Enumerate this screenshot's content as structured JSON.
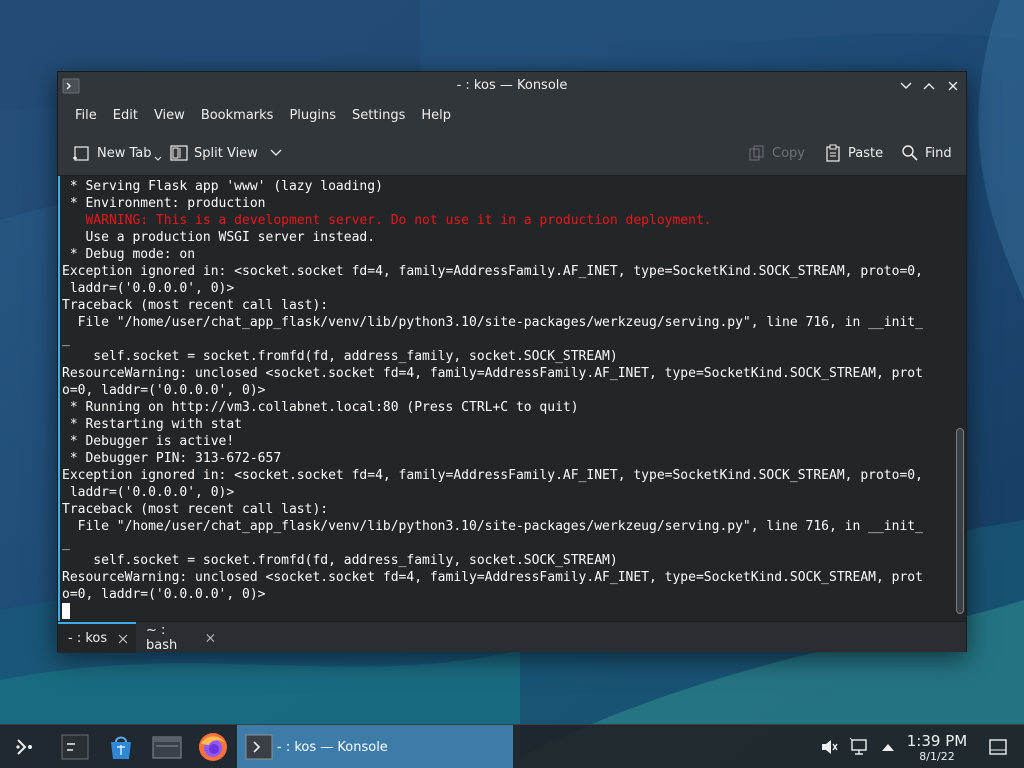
{
  "window": {
    "title": "- : kos — Konsole"
  },
  "menu": [
    "File",
    "Edit",
    "View",
    "Bookmarks",
    "Plugins",
    "Settings",
    "Help"
  ],
  "toolbar": {
    "new_tab": "New Tab",
    "split_view": "Split View",
    "copy": "Copy",
    "paste": "Paste",
    "find": "Find"
  },
  "terminal": {
    "lines": [
      {
        "text": " * Serving Flask app 'www' (lazy loading)",
        "warn": false
      },
      {
        "text": " * Environment: production",
        "warn": false
      },
      {
        "text": "   WARNING: This is a development server. Do not use it in a production deployment.",
        "warn": true
      },
      {
        "text": "   Use a production WSGI server instead.",
        "warn": false
      },
      {
        "text": " * Debug mode: on",
        "warn": false
      },
      {
        "text": "Exception ignored in: <socket.socket fd=4, family=AddressFamily.AF_INET, type=SocketKind.SOCK_STREAM, proto=0,",
        "warn": false
      },
      {
        "text": " laddr=('0.0.0.0', 0)>",
        "warn": false
      },
      {
        "text": "Traceback (most recent call last):",
        "warn": false
      },
      {
        "text": "  File \"/home/user/chat_app_flask/venv/lib/python3.10/site-packages/werkzeug/serving.py\", line 716, in __init_",
        "warn": false
      },
      {
        "text": "_",
        "warn": false
      },
      {
        "text": "    self.socket = socket.fromfd(fd, address_family, socket.SOCK_STREAM)",
        "warn": false
      },
      {
        "text": "ResourceWarning: unclosed <socket.socket fd=4, family=AddressFamily.AF_INET, type=SocketKind.SOCK_STREAM, prot",
        "warn": false
      },
      {
        "text": "o=0, laddr=('0.0.0.0', 0)>",
        "warn": false
      },
      {
        "text": " * Running on http://vm3.collabnet.local:80 (Press CTRL+C to quit)",
        "warn": false
      },
      {
        "text": " * Restarting with stat",
        "warn": false
      },
      {
        "text": " * Debugger is active!",
        "warn": false
      },
      {
        "text": " * Debugger PIN: 313-672-657",
        "warn": false
      },
      {
        "text": "Exception ignored in: <socket.socket fd=4, family=AddressFamily.AF_INET, type=SocketKind.SOCK_STREAM, proto=0,",
        "warn": false
      },
      {
        "text": " laddr=('0.0.0.0', 0)>",
        "warn": false
      },
      {
        "text": "Traceback (most recent call last):",
        "warn": false
      },
      {
        "text": "  File \"/home/user/chat_app_flask/venv/lib/python3.10/site-packages/werkzeug/serving.py\", line 716, in __init_",
        "warn": false
      },
      {
        "text": "_",
        "warn": false
      },
      {
        "text": "    self.socket = socket.fromfd(fd, address_family, socket.SOCK_STREAM)",
        "warn": false
      },
      {
        "text": "ResourceWarning: unclosed <socket.socket fd=4, family=AddressFamily.AF_INET, type=SocketKind.SOCK_STREAM, prot",
        "warn": false
      },
      {
        "text": "o=0, laddr=('0.0.0.0', 0)>",
        "warn": false
      }
    ]
  },
  "tabs": [
    {
      "label": "- : kos",
      "active": true
    },
    {
      "label": "~ : bash",
      "active": false
    }
  ],
  "taskbar": {
    "task_label": "- : kos — Konsole",
    "time": "1:39 PM",
    "date": "8/1/22"
  },
  "icons": {
    "app": "konsole-icon",
    "launcher": "application-launcher-icon",
    "pager": "virtual-desktop-icon",
    "store": "discover-store-icon",
    "files": "file-manager-icon",
    "browser": "firefox-icon",
    "audio": "audio-muted-icon",
    "network": "network-icon",
    "tray": "tray-expand-icon",
    "desktop": "show-desktop-icon"
  },
  "colors": {
    "accent": "#3daee9",
    "warning": "#ed1515",
    "terminal_bg": "#232629",
    "task_active": "#3d7ba8"
  }
}
